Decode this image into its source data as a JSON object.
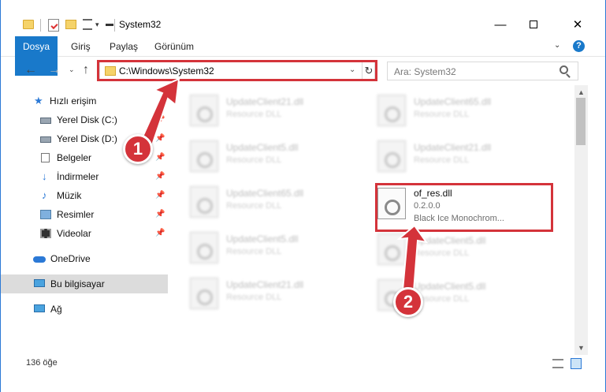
{
  "window": {
    "title": "System32",
    "minimize_label": "—",
    "close_label": "✕"
  },
  "ribbon": {
    "tabs": [
      {
        "label": "Dosya"
      },
      {
        "label": "Giriş"
      },
      {
        "label": "Paylaş"
      },
      {
        "label": "Görünüm"
      }
    ],
    "help": "?"
  },
  "nav": {
    "back": "←",
    "forward": "→",
    "recent": "⌄",
    "up": "↑",
    "address": "C:\\Windows\\System32",
    "address_dropdown": "⌄",
    "refresh": "↻",
    "search_placeholder": "Ara: System32"
  },
  "sidebar": {
    "items": [
      {
        "label": "Hızlı erişim",
        "icon": "star-icon"
      },
      {
        "label": "Yerel Disk (C:)",
        "icon": "drive-icon",
        "pinned": true
      },
      {
        "label": "Yerel Disk (D:)",
        "icon": "drive-icon",
        "pinned": true
      },
      {
        "label": "Belgeler",
        "icon": "documents-icon",
        "pinned": true
      },
      {
        "label": "İndirmeler",
        "icon": "download-icon",
        "pinned": true
      },
      {
        "label": "Müzik",
        "icon": "music-icon",
        "pinned": true
      },
      {
        "label": "Resimler",
        "icon": "pictures-icon",
        "pinned": true
      },
      {
        "label": "Videolar",
        "icon": "videos-icon",
        "pinned": true
      },
      {
        "label": "OneDrive",
        "icon": "cloud-icon"
      },
      {
        "label": "Bu bilgisayar",
        "icon": "computer-icon",
        "selected": true
      },
      {
        "label": "Ağ",
        "icon": "network-icon"
      }
    ],
    "pin_glyph": "📌"
  },
  "files": {
    "left": [
      {
        "name": "UpdateClient21.dll",
        "desc": "Resource DLL"
      },
      {
        "name": "UpdateClient5.dll",
        "desc": "Resource DLL"
      },
      {
        "name": "UpdateClient65.dll",
        "desc": "Resource DLL"
      },
      {
        "name": "UpdateClient5.dll",
        "desc": "Resource DLL"
      },
      {
        "name": "UpdateClient21.dll",
        "desc": "Resource DLL"
      }
    ],
    "right": [
      {
        "name": "UpdateClient65.dll",
        "desc": "Resource DLL"
      },
      {
        "name": "UpdateClient21.dll",
        "desc": "Resource DLL"
      },
      {
        "name": "UpdateClient5.dll",
        "desc": "Resource DLL"
      },
      {
        "name": "UpdateClient5.dll",
        "desc": "Resource DLL"
      }
    ],
    "target": {
      "name": "of_res.dll",
      "version": "0.2.0.0",
      "desc": "Black Ice Monochrom..."
    }
  },
  "status": {
    "count": "136 öğe"
  },
  "callouts": {
    "one": "1",
    "two": "2"
  },
  "colors": {
    "accent": "#1979ca",
    "highlight": "#d4333a"
  }
}
